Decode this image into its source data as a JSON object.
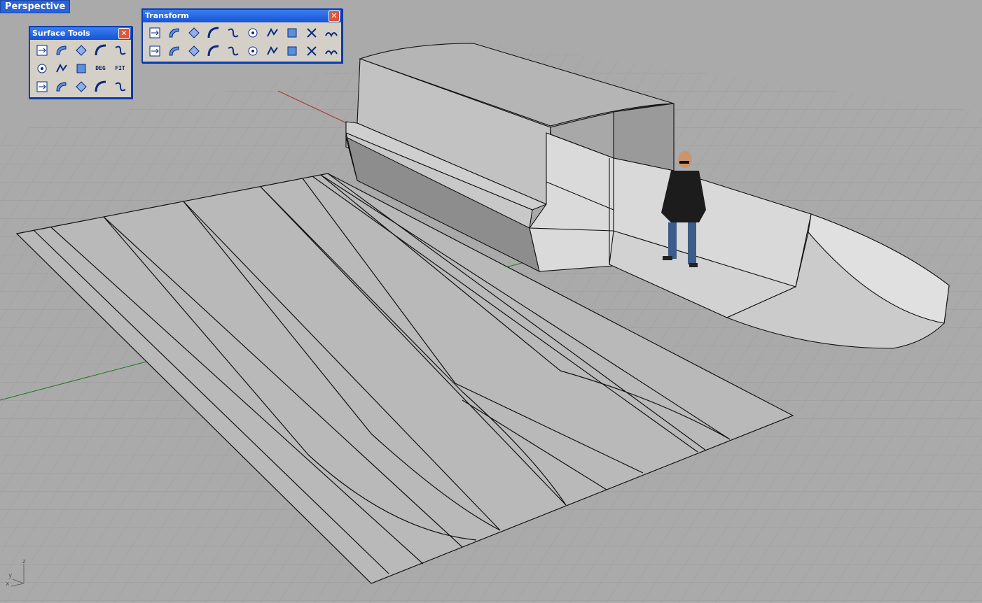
{
  "viewport": {
    "title": "Perspective",
    "colors": {
      "background": "#a9a9a9",
      "grid": "#9e9e9e",
      "x_axis": "#b03030",
      "y_axis": "#1a7a1a",
      "model_light": "#d4d4d4",
      "model_mid": "#bdbdbd",
      "model_dark": "#8e8e8e"
    },
    "axis_labels": {
      "z": "z",
      "y": "y",
      "x": "x"
    }
  },
  "surface_tools": {
    "title": "Surface Tools",
    "close_icon": "close-icon",
    "buttons": [
      {
        "name": "extend-surface-icon"
      },
      {
        "name": "fillet-surface-icon"
      },
      {
        "name": "chamfer-surface-icon"
      },
      {
        "name": "variable-fillet-icon"
      },
      {
        "name": "blend-surface-icon"
      },
      {
        "name": "offset-surface-icon"
      },
      {
        "name": "match-surface-icon"
      },
      {
        "name": "merge-surface-icon"
      },
      {
        "name": "change-degree-icon",
        "text": "DEG"
      },
      {
        "name": "refit-icon",
        "text": "FIT"
      },
      {
        "name": "connect-surface-icon"
      },
      {
        "name": "symmetry-icon"
      },
      {
        "name": "shrink-surface-icon"
      },
      {
        "name": "untrim-icon"
      },
      {
        "name": "split-edge-icon"
      }
    ]
  },
  "transform": {
    "title": "Transform",
    "close_icon": "close-icon",
    "buttons": [
      {
        "name": "move-icon"
      },
      {
        "name": "copy-icon"
      },
      {
        "name": "rotate-icon"
      },
      {
        "name": "scale-icon"
      },
      {
        "name": "mirror-icon"
      },
      {
        "name": "orient-icon"
      },
      {
        "name": "orient-on-surface-icon"
      },
      {
        "name": "flow-along-curve-icon"
      },
      {
        "name": "set-points-icon"
      },
      {
        "name": "splop-icon"
      },
      {
        "name": "array-icon"
      },
      {
        "name": "polar-array-icon"
      },
      {
        "name": "array-along-curve-icon"
      },
      {
        "name": "align-icon"
      },
      {
        "name": "twist-icon"
      },
      {
        "name": "bend-icon"
      },
      {
        "name": "taper-icon"
      },
      {
        "name": "stretch-icon"
      },
      {
        "name": "shear-icon"
      },
      {
        "name": "smash-icon"
      }
    ]
  }
}
